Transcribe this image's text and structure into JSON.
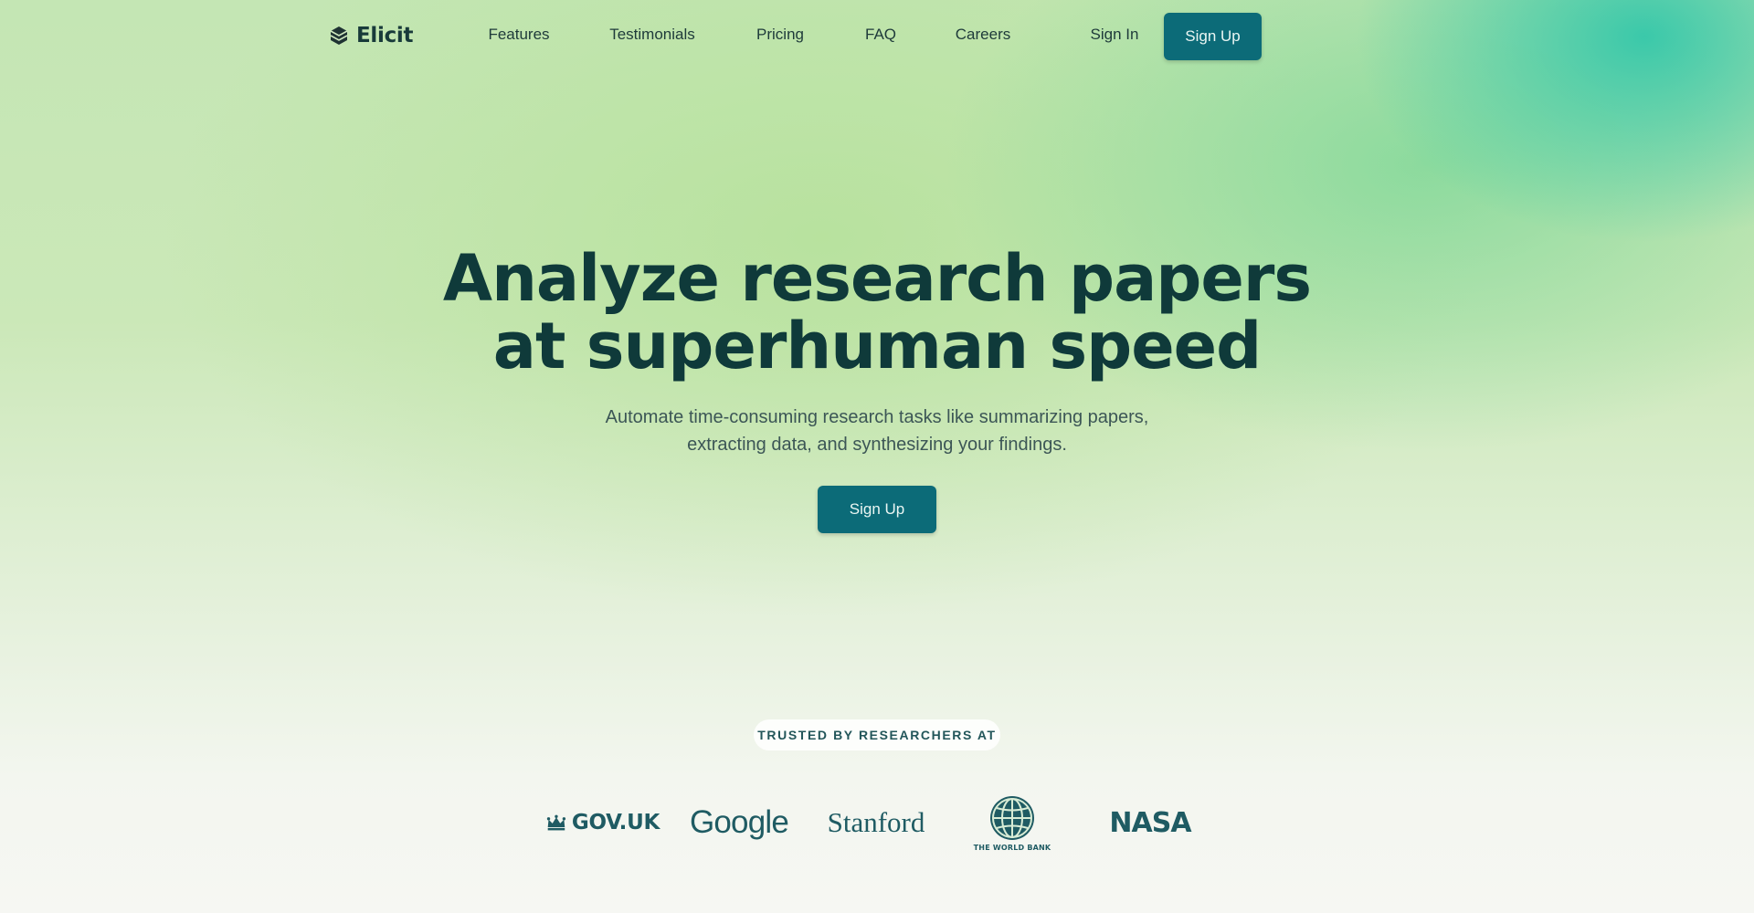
{
  "brand": {
    "name": "Elicit"
  },
  "nav": {
    "links": [
      "Features",
      "Testimonials",
      "Pricing",
      "FAQ",
      "Careers"
    ],
    "sign_in": "Sign In",
    "sign_up": "Sign Up"
  },
  "hero": {
    "title_line1": "Analyze research papers",
    "title_line2": "at superhuman speed",
    "subtitle_line1": "Automate time-consuming research tasks like summarizing papers,",
    "subtitle_line2": "extracting data, and synthesizing your findings.",
    "cta": "Sign Up"
  },
  "trusted": {
    "label": "TRUSTED BY RESEARCHERS AT",
    "logos": {
      "gov": "GOV.UK",
      "google": "Google",
      "stanford": "Stanford",
      "worldbank": "THE WORLD BANK",
      "nasa": "NASA"
    }
  },
  "colors": {
    "primary_button": "#0c6b78",
    "heading": "#0f3a3a",
    "logo_tint": "#1f5b63"
  }
}
